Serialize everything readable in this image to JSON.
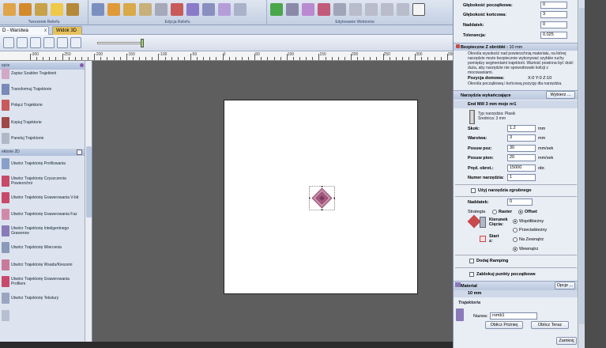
{
  "toolbar": {
    "groups": [
      {
        "label": "Tworzenie Reliefu"
      },
      {
        "label": "Edycja Reliefu"
      },
      {
        "label": "Edytowanie Wektorów"
      }
    ]
  },
  "tabs": [
    {
      "label": "D - Warstwa Bitmapy",
      "close": "x"
    },
    {
      "label": "Widok 3D"
    }
  ],
  "ruler": {
    "labels": [
      "-300",
      "-250",
      "-200",
      "-150",
      "-100",
      "-50",
      "0",
      "50",
      "100",
      "150",
      "200",
      "250",
      "300",
      "350",
      "400"
    ]
  },
  "left_panel": {
    "section1": "ejcie",
    "items_top": [
      "Zapisz Szablon Trajektorii",
      "Transformuj Trajektorie",
      "Połącz Trajektorie",
      "Kopiuj Trajektorie",
      "Paneluj Trajektorie"
    ],
    "section2": "ektorie 2D",
    "items_2d": [
      "Utwórz Trajektorię Profilowania",
      "Utwórz Trajektorię Czyszczenia Powierzchni",
      "Utwórz Trajektorię Grawerowania V-bit",
      "Utwórz Trajektorię Grawerowania Faz",
      "Utwórz Trajektorię Inteligentnego Grawerow",
      "Utwórz Trajektorię Wiercenia",
      "Utwórz Trajektorię Wsadu/Kieszeni",
      "Utwórz Trajektorię Grawerowania Profilem",
      "Utwórz Trajektorię Tekstury"
    ]
  },
  "right_panel": {
    "glebokosc_poczatkowa": {
      "label": "Głębokość początkowa:",
      "value": "0"
    },
    "glebokosc_koncowa": {
      "label": "Głębokość końcowa:",
      "value": "3"
    },
    "naddatek_top": {
      "label": "Naddatek:",
      "value": "0"
    },
    "tolerancja": {
      "label": "Tolerancja:",
      "value": "0.025"
    },
    "bezpieczne": {
      "label": "Bezpieczne Z obróbki :",
      "value": "10 mm"
    },
    "bezpieczne_desc": "Określa wysokość nad powierzchnią materiału, na której narzędzie może bezpiecznie wykonywać szybkie ruchy pomiędzy segmentami trajektorii. Wartość powinna być dość duża, aby narzędzie nie spowodowało kolizji z mocowaniami.",
    "pozycja_domowa": {
      "label": "Pozycja domowa:",
      "value": "X:0 Y:0 Z:10"
    },
    "pozycja_desc": "Określa początkową i końcową pozycję dla narzędzia.",
    "narzedzia_section": "Narzędzia wykańczające",
    "wybierz": "Wybierz ...",
    "tool_name": "End Mill 3 mm moje nr1",
    "tool_type": "Typ narzędzia: Płaski",
    "tool_diameter": "Średnica:   3 mm",
    "params": [
      {
        "label": "Skok:",
        "value": "1.2",
        "unit": "mm"
      },
      {
        "label": "Warstwa:",
        "value": "3",
        "unit": "mm"
      },
      {
        "label": "Posuw poz:",
        "value": "30",
        "unit": "mm/sek"
      },
      {
        "label": "Posuw pion:",
        "value": "20",
        "unit": "mm/sek"
      },
      {
        "label": "Pręd. obrot.:",
        "value": "15000",
        "unit": "obr."
      },
      {
        "label": "Numer narzędzia:",
        "value": "1",
        "unit": ""
      }
    ],
    "uzyj_zgrubnego": "Użyj narzędzia zgrubnego",
    "naddatek2": {
      "label": "Naddatek:",
      "value": "0"
    },
    "strategia": {
      "label": "Strategia",
      "raster": "Raster",
      "offset": "Offset"
    },
    "kierunek": {
      "label": "Kierunek Cięcia:",
      "opt1": "Współbieżny",
      "opt2": "Przeciwbieżny"
    },
    "start": {
      "label": "Start z:",
      "opt1": "Na Zewnątrz",
      "opt2": "Wewnątrz"
    },
    "dodaj_ramping": "Dodaj Ramping",
    "zablokuj": "Zablokuj punkty początkowe",
    "material": {
      "label": "Materiał",
      "button": "Opcje ...",
      "value": "10 mm"
    },
    "trajektoria": {
      "title": "Trajektoria",
      "nazwa_label": "Nazwa:",
      "nazwa_value": "romb1",
      "oblicz_pozniej": "Oblicz Później",
      "oblicz_teraz": "Oblicz Teraz"
    },
    "zamknij": "Zamknij"
  },
  "colors": {
    "panel_bg": "#e9edf4",
    "canvas_bg": "#5e5e5e",
    "accent_tab": "#e6c25e"
  }
}
